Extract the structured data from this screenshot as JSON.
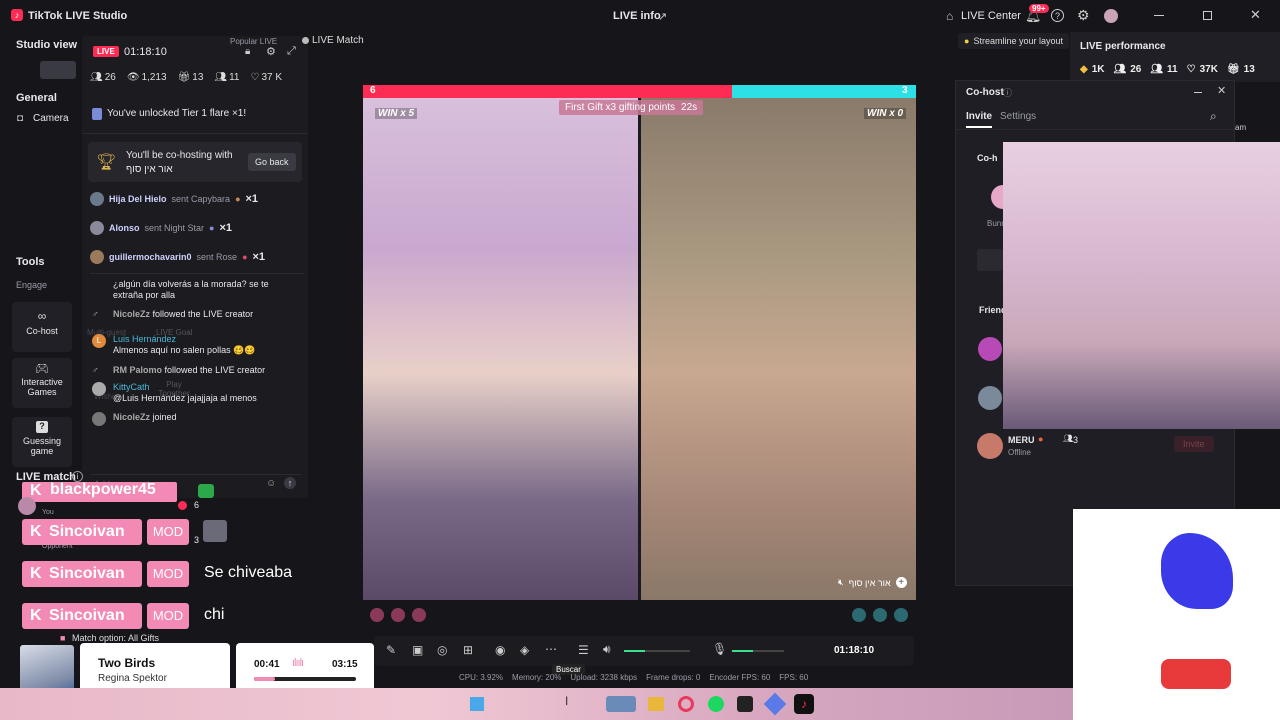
{
  "titlebar": {
    "app_title": "TikTok LIVE Studio",
    "center": "LIVE info",
    "live_center": "LIVE Center",
    "notif_badge": "99+"
  },
  "left": {
    "studio_view": "Studio view",
    "general": "General",
    "camera": "Camera",
    "tools": "Tools",
    "engage": "Engage",
    "cohost": "Co-host",
    "interactive": "Interactive Games",
    "guessing": "Guessing game",
    "live_match": "LIVE match"
  },
  "stats": {
    "live_badge": "LIVE",
    "timer": "01:18:10",
    "viewers": "26",
    "views": "1,213",
    "gifts": "13",
    "members": "11",
    "likes": "37 K",
    "popular": "Popular LIVE",
    "live_match_btn": "LIVE Match"
  },
  "chat": {
    "tier": "You've unlocked Tier 1 flare ×1!",
    "cohost_line1": "You'll be co-hosting with",
    "cohost_line2": "אור אין סוף",
    "go_back": "Go back",
    "gifts": [
      {
        "name": "Hija Del Hielo",
        "action": "sent Capybara",
        "count": "×1"
      },
      {
        "name": "Alonso",
        "action": "sent Night Star",
        "count": "×1"
      },
      {
        "name": "guillermochavarin0",
        "action": "sent Rose",
        "count": "×1"
      }
    ],
    "messages": [
      {
        "name": "",
        "text": "¿algún día volverás a la morada? se te extraña por alla"
      },
      {
        "name": "NicoleZz",
        "text": "followed the LIVE creator"
      },
      {
        "name": "Luis Hernández",
        "text": "Almenos aquí no salen pollas 🥴🥴"
      },
      {
        "name": "RM Palomo",
        "text": "followed the LIVE creator"
      },
      {
        "name": "KittyCath",
        "text": "@Luis Hernández jajajjaja al menos"
      },
      {
        "name": "NicoleZz",
        "text": "joined"
      }
    ],
    "placeholder": "Add comment",
    "ghost_multiguest": "Multi-guest",
    "ghost_livegoal": "LIVE Goal",
    "ghost_play": "Play Together",
    "ghost_wishes": "Wishes"
  },
  "overlay": {
    "top_name": "blackpower45",
    "you": "You",
    "opponent": "Opponent",
    "top_rank": "6",
    "rank2": "3",
    "rows": [
      {
        "name": "Sincoivan",
        "badge": "MOD",
        "text": ""
      },
      {
        "name": "Sincoivan",
        "badge": "MOD",
        "text": "Se chiveaba"
      },
      {
        "name": "Sincoivan",
        "badge": "MOD",
        "text": "chi"
      }
    ],
    "match_option": "Match option: All Gifts"
  },
  "music": {
    "title": "Two Birds",
    "artist": "Regina Spektor",
    "elapsed": "00:41",
    "total": "03:15",
    "progress": 0.21
  },
  "battle": {
    "left_score": "6",
    "right_score": "3",
    "left_ratio": 0.667,
    "banner": "First Gift x3 gifting points",
    "countdown": "22s",
    "win_left": "WIN x 5",
    "win_right": "WIN x 0",
    "tag": "אור אין סוף"
  },
  "toolbar": {
    "timer": "01:18:10",
    "tooltip": "Buscar",
    "volume": 0.32,
    "mic": 0.4
  },
  "status": {
    "cpu": "CPU: 3.92%",
    "memory": "Memory: 20%",
    "upload": "Upload: 3238 kbps",
    "frame_drops": "Frame drops: 0",
    "encoder": "Encoder FPS: 60",
    "fps": "FPS: 60"
  },
  "right": {
    "streamline": "Streamline your layout",
    "live_perf": "LIVE performance",
    "perf": {
      "diamonds": "1K",
      "viewers": "26",
      "members": "11",
      "likes": "37K",
      "gifts": "13"
    },
    "cohost_title": "Co-host",
    "tab_invite": "Invite",
    "tab_settings": "Settings",
    "cohost_trunc": "Co-h",
    "bunny_trunc": "Bunn",
    "friends_trunc": "Friend",
    "team_trunc": "am",
    "meru_name": "MERU",
    "meru_count": "3",
    "meru_status": "Offline",
    "invite_btn": "Invite"
  },
  "colors": {
    "accent": "#fe2c55",
    "cyan": "#2ce0e6",
    "panel": "#1f1f25",
    "bg": "#16161a"
  }
}
